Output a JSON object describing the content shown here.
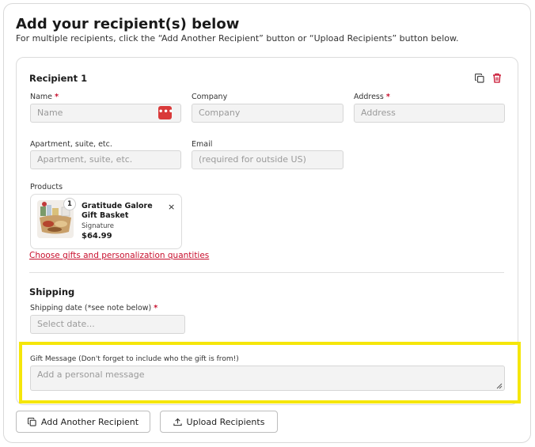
{
  "header": {
    "title": "Add your recipient(s) below",
    "subtitle": "For multiple recipients, click the “Add Another Recipient” button or “Upload Recipients” button below."
  },
  "recipient": {
    "title": "Recipient 1",
    "fields": {
      "name": {
        "label": "Name",
        "required_mark": "*",
        "placeholder": "Name",
        "badge": "•••"
      },
      "company": {
        "label": "Company",
        "placeholder": "Company"
      },
      "address": {
        "label": "Address",
        "required_mark": "*",
        "placeholder": "Address"
      },
      "apartment": {
        "label": "Apartment, suite, etc.",
        "placeholder": "Apartment, suite, etc."
      },
      "email": {
        "label": "Email",
        "placeholder": "(required for outside US)"
      }
    },
    "products": {
      "label": "Products",
      "items": [
        {
          "quantity": "1",
          "name": "Gratitude Galore Gift Basket",
          "variant": "Signature",
          "price": "$64.99",
          "remove": "×"
        }
      ],
      "choose_link": "Choose gifts and personalization quantities"
    }
  },
  "shipping": {
    "title": "Shipping",
    "date_label": "Shipping date (*see note below)",
    "required_mark": "*",
    "date_placeholder": "Select date..."
  },
  "gift_message": {
    "label": "Gift Message (Don't forget to include who the gift is from!)",
    "placeholder": "Add a personal message"
  },
  "actions": {
    "add_recipient": "Add Another Recipient",
    "upload_recipients": "Upload Recipients"
  },
  "colors": {
    "accent": "#c8102e",
    "highlight": "#f5e60a"
  }
}
